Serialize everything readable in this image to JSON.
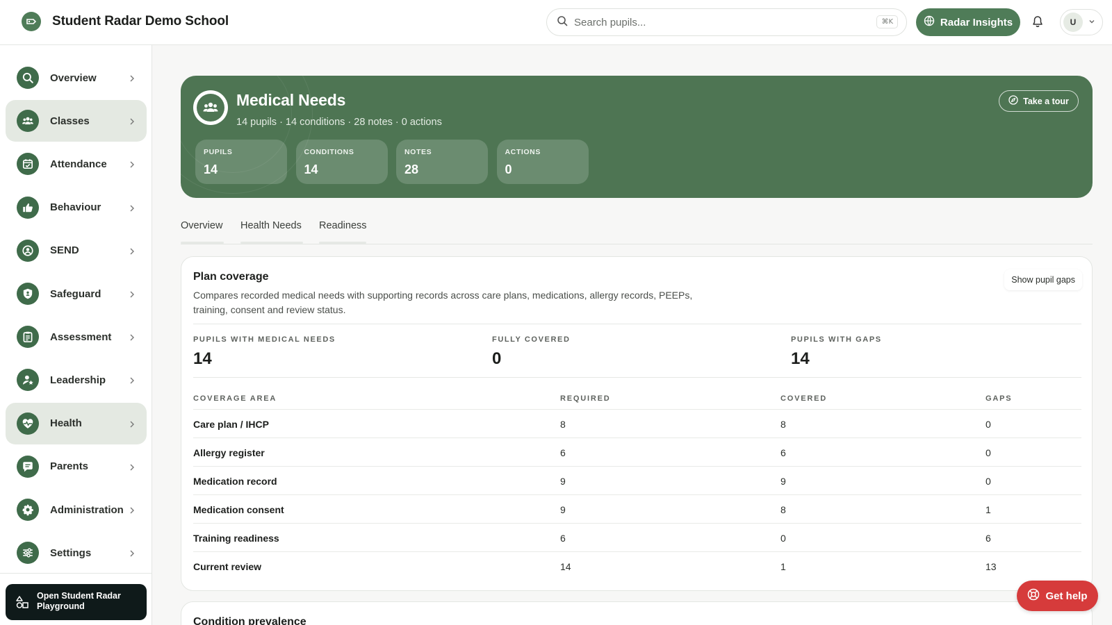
{
  "header": {
    "school_name": "Student Radar Demo School",
    "search_placeholder": "Search pupils...",
    "search_shortcut": "⌘K",
    "insights_label": "Radar Insights",
    "avatar_initial": "U"
  },
  "sidebar": {
    "items": [
      {
        "label": "Overview",
        "icon": "search-icon"
      },
      {
        "label": "Classes",
        "icon": "users-icon",
        "active": true
      },
      {
        "label": "Attendance",
        "icon": "calendar-check-icon"
      },
      {
        "label": "Behaviour",
        "icon": "thumbs-up-icon"
      },
      {
        "label": "SEND",
        "icon": "user-circle-icon"
      },
      {
        "label": "Safeguard",
        "icon": "shield-icon"
      },
      {
        "label": "Assessment",
        "icon": "clipboard-icon"
      },
      {
        "label": "Leadership",
        "icon": "user-star-icon"
      },
      {
        "label": "Health",
        "icon": "heart-pulse-icon",
        "active": true
      },
      {
        "label": "Parents",
        "icon": "message-icon"
      },
      {
        "label": "Administration",
        "icon": "gear-icon"
      },
      {
        "label": "Settings",
        "icon": "sliders-icon"
      }
    ],
    "playground_label": "Open Student Radar Playground"
  },
  "hero": {
    "title": "Medical Needs",
    "subtitle": "14 pupils · 14 conditions · 28 notes · 0 actions",
    "tour_label": "Take a tour",
    "stats": [
      {
        "label": "PUPILS",
        "value": "14"
      },
      {
        "label": "CONDITIONS",
        "value": "14"
      },
      {
        "label": "NOTES",
        "value": "28"
      },
      {
        "label": "ACTIONS",
        "value": "0"
      }
    ]
  },
  "tabs": [
    "Overview",
    "Health Needs",
    "Readiness"
  ],
  "coverage": {
    "title": "Plan coverage",
    "description": "Compares recorded medical needs with supporting records across care plans, medications, allergy records, PEEPs, training, consent and review status.",
    "gaps_button": "Show pupil gaps",
    "metrics": [
      {
        "label": "PUPILS WITH MEDICAL NEEDS",
        "value": "14"
      },
      {
        "label": "FULLY COVERED",
        "value": "0"
      },
      {
        "label": "PUPILS WITH GAPS",
        "value": "14"
      }
    ],
    "columns": [
      "COVERAGE AREA",
      "REQUIRED",
      "COVERED",
      "GAPS"
    ],
    "rows": [
      {
        "area": "Care plan / IHCP",
        "required": "8",
        "covered": "8",
        "gaps": "0"
      },
      {
        "area": "Allergy register",
        "required": "6",
        "covered": "6",
        "gaps": "0"
      },
      {
        "area": "Medication record",
        "required": "9",
        "covered": "9",
        "gaps": "0"
      },
      {
        "area": "Medication consent",
        "required": "9",
        "covered": "8",
        "gaps": "1"
      },
      {
        "area": "Training readiness",
        "required": "6",
        "covered": "0",
        "gaps": "6"
      },
      {
        "area": "Current review",
        "required": "14",
        "covered": "1",
        "gaps": "13"
      }
    ]
  },
  "prevalence": {
    "title": "Condition prevalence"
  },
  "help": {
    "label": "Get help"
  },
  "colors": {
    "brand_green": "#4f7c58",
    "hero_green": "#4e7553",
    "help_red": "#d63b3b"
  }
}
